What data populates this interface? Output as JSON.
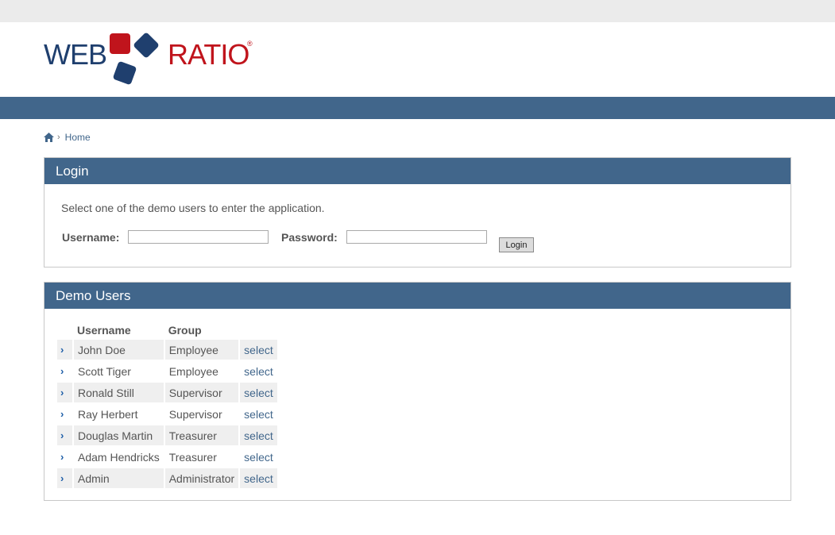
{
  "brand": {
    "word1": "WEB",
    "word2": "RATIO",
    "mark": "®",
    "colors": {
      "navy": "#1f3f6e",
      "red": "#c0141c",
      "bar": "#41668b"
    }
  },
  "breadcrumb": {
    "icon": "home-icon",
    "separator": "›",
    "current": "Home"
  },
  "login": {
    "title": "Login",
    "instructions": "Select one of the demo users to enter the application.",
    "username_label": "Username:",
    "username_value": "",
    "password_label": "Password:",
    "password_value": "",
    "button_label": "Login"
  },
  "demo_users": {
    "title": "Demo Users",
    "columns": [
      "Username",
      "Group"
    ],
    "rows": [
      {
        "arrow": "›",
        "username": "John Doe",
        "group": "Employee",
        "action": "select"
      },
      {
        "arrow": "›",
        "username": "Scott Tiger",
        "group": "Employee",
        "action": "select"
      },
      {
        "arrow": "›",
        "username": "Ronald Still",
        "group": "Supervisor",
        "action": "select"
      },
      {
        "arrow": "›",
        "username": "Ray Herbert",
        "group": "Supervisor",
        "action": "select"
      },
      {
        "arrow": "›",
        "username": "Douglas Martin",
        "group": "Treasurer",
        "action": "select"
      },
      {
        "arrow": "›",
        "username": "Adam Hendricks",
        "group": "Treasurer",
        "action": "select"
      },
      {
        "arrow": "›",
        "username": "Admin",
        "group": "Administrator",
        "action": "select"
      }
    ]
  }
}
